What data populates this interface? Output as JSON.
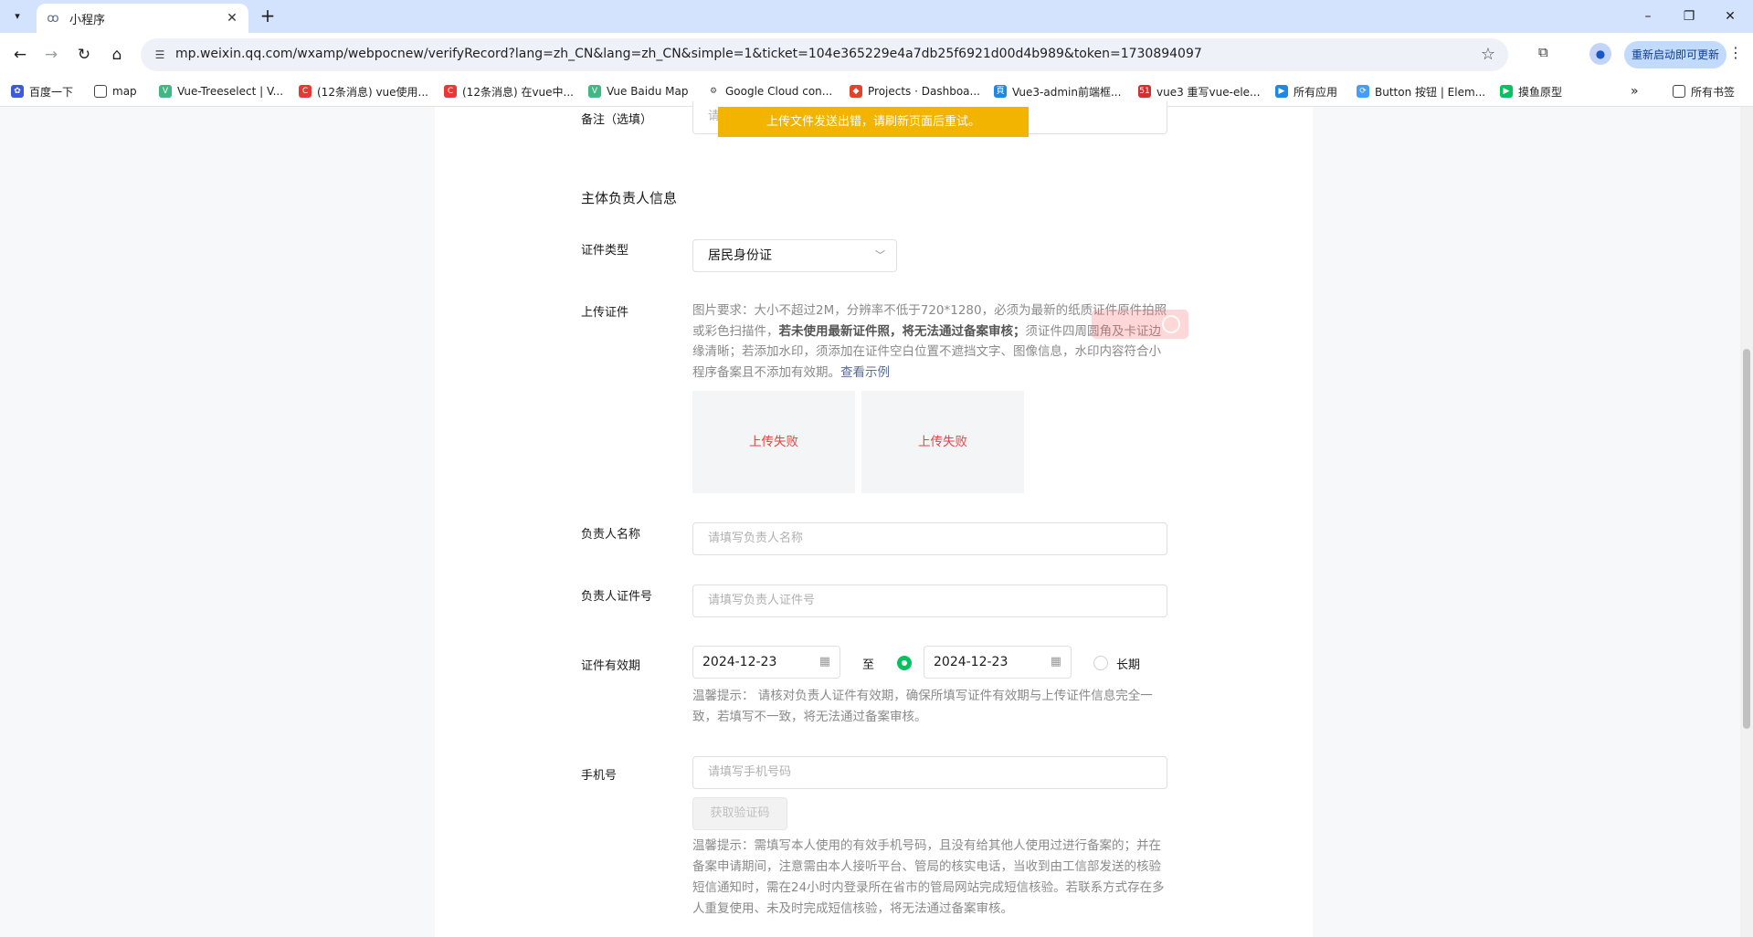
{
  "browser": {
    "tab_title": "小程序",
    "url": "mp.weixin.qq.com/wxamp/webpocnew/verifyRecord?lang=zh_CN&lang=zh_CN&simple=1&ticket=104e365229e4a7db25f6921d00d4b989&token=1730894097",
    "update_button": "重新启动即可更新",
    "bookmarks": [
      {
        "label": "百度一下",
        "icon": "paw-icon"
      },
      {
        "label": "map",
        "icon": "folder-icon"
      },
      {
        "label": "Vue-Treeselect | V...",
        "icon": "vue-icon"
      },
      {
        "label": "(12条消息) vue使用...",
        "icon": "csdn-icon"
      },
      {
        "label": "(12条消息) 在vue中...",
        "icon": "csdn-icon"
      },
      {
        "label": "Vue Baidu Map",
        "icon": "vue-icon"
      },
      {
        "label": "Google Cloud con...",
        "icon": "globe-icon"
      },
      {
        "label": "Projects · Dashboa...",
        "icon": "gitlab-icon"
      },
      {
        "label": "Vue3-admin前端框...",
        "icon": "blue-square-icon"
      },
      {
        "label": "vue3 重写vue-ele...",
        "icon": "fiftyone-icon"
      },
      {
        "label": "所有应用",
        "icon": "play-icon"
      },
      {
        "label": "Button 按钮 | Elem...",
        "icon": "element-icon"
      },
      {
        "label": "摸鱼原型",
        "icon": "green-play-icon"
      }
    ],
    "all_bookmarks": "所有书签"
  },
  "toast": "上传文件发送出错，请刷新页面后重试。",
  "form": {
    "remark": {
      "label": "备注（选填）",
      "placeholder": "请"
    },
    "section_title": "主体负责人信息",
    "id_type": {
      "label": "证件类型",
      "value": "居民身份证"
    },
    "upload": {
      "label": "上传证件",
      "hint_part1": "图片要求：大小不超过2M，分辨率不低于720*1280，必须为最新的纸质证件原件拍照或彩色扫描件，",
      "hint_bold": "若未使用最新证件照，将无法通过备案审核；",
      "hint_part2": "须证件四周圆角及卡证边缘清晰；若添加水印，须添加在证件空白位置不遮挡文字、图像信息，水印内容符合小程序备案且不添加有效期。",
      "example_link": "查看示例",
      "failed_1": "上传失败",
      "failed_2": "上传失败"
    },
    "name": {
      "label": "负责人名称",
      "placeholder": "请填写负责人名称"
    },
    "id_number": {
      "label": "负责人证件号",
      "placeholder": "请填写负责人证件号"
    },
    "validity": {
      "label": "证件有效期",
      "start": "2024-12-23",
      "to": "至",
      "end": "2024-12-23",
      "long_term": "长期",
      "tip": "温馨提示： 请核对负责人证件有效期，确保所填写证件有效期与上传证件信息完全一致，若填写不一致，将无法通过备案审核。"
    },
    "phone": {
      "label": "手机号",
      "placeholder": "请填写手机号码",
      "code_button": "获取验证码",
      "tip": "温馨提示：需填写本人使用的有效手机号码，且没有给其他人使用过进行备案的；并在备案申请期间，注意需由本人接听平台、管局的核实电话，当收到由工信部发送的核验短信通知时，需在24小时内登录所在省市的管局网站完成短信核验。若联系方式存在多人重复使用、未及时完成短信核验，将无法通过备案审核。"
    }
  },
  "colors": {
    "accent_green": "#07c160",
    "toast_bg": "#f3b400",
    "error_red": "#e64340",
    "link_blue": "#576b95"
  }
}
